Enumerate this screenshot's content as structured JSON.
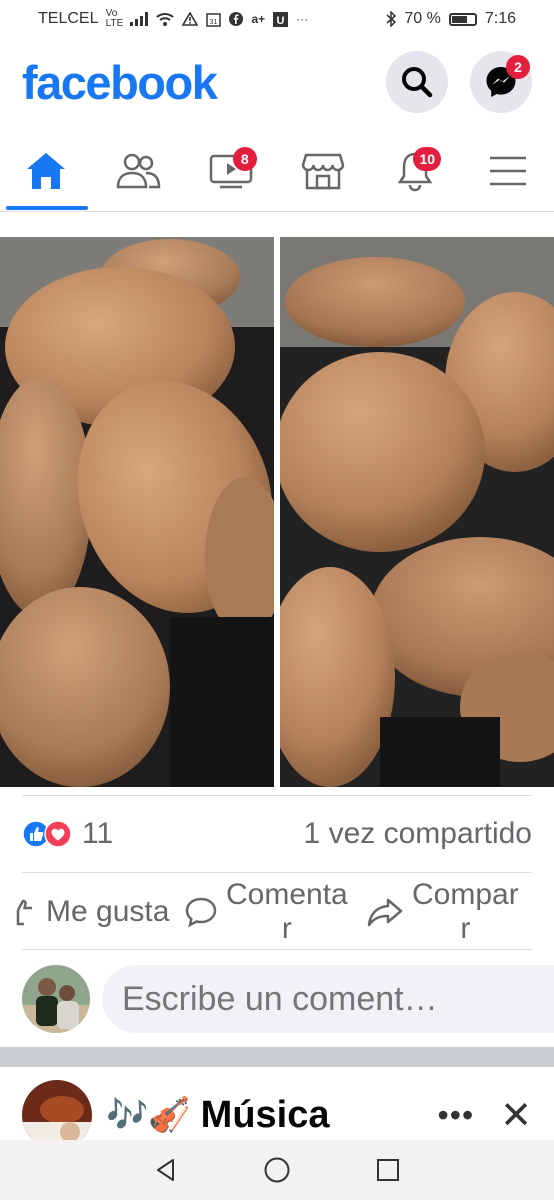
{
  "status_bar": {
    "carrier": "TELCEL",
    "network": "Vo LTE",
    "battery_percent": "70 %",
    "battery_level": 0.7,
    "time": "7:16",
    "icons": [
      "signal-icon",
      "wifi-icon",
      "warning-icon",
      "calendar-icon",
      "facebook-icon",
      "plus-icon",
      "u-icon",
      "more-icon",
      "bluetooth-icon",
      "battery-icon"
    ]
  },
  "header": {
    "logo": "facebook",
    "messenger_badge": "2"
  },
  "nav": {
    "tabs": [
      {
        "name": "home",
        "icon": "home-icon",
        "active": true
      },
      {
        "name": "friends",
        "icon": "friends-icon"
      },
      {
        "name": "watch",
        "icon": "video-icon",
        "badge": "8"
      },
      {
        "name": "marketplace",
        "icon": "store-icon"
      },
      {
        "name": "notifications",
        "icon": "bell-icon",
        "badge": "10"
      },
      {
        "name": "menu",
        "icon": "hamburger-icon"
      }
    ]
  },
  "post": {
    "photos": [
      "bread-photo-left",
      "bread-photo-right"
    ],
    "reaction_count": "11",
    "shares": "1 vez compartido",
    "actions": {
      "like": "Me gusta",
      "comment_line1": "Comenta",
      "comment_line2": "r",
      "share_line1": "Compar",
      "share_line2": "r"
    },
    "comment_placeholder": "Escribe un coment…"
  },
  "next_post": {
    "emoji": "🎶🎻",
    "title": "Música",
    "more": "•••",
    "close": "✕"
  },
  "colors": {
    "brand": "#1877f2",
    "badge": "#e41e3f",
    "muted_text": "#65676b",
    "comment_bg": "#f0f2f5"
  }
}
